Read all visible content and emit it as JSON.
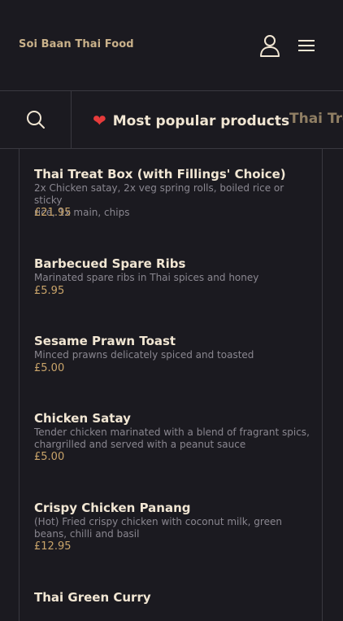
{
  "header": {
    "brand": "Soi Baan Thai Food",
    "user_icon": "user-icon",
    "menu_icon": "menu-icon"
  },
  "tabs": {
    "search_icon": "search-icon",
    "items": [
      {
        "label": "Most popular products",
        "icon": "heart-icon",
        "active": true
      },
      {
        "label": "Thai Treat",
        "active": false
      }
    ]
  },
  "products": [
    {
      "title": "Thai Treat Box (with Fillings' Choice)",
      "desc_lines": [
        "2x Chicken satay, 2x veg spring rolls, boiled rice or sticky",
        "rice, 1x main, chips"
      ],
      "price": "£21.95"
    },
    {
      "title": "Barbecued Spare Ribs",
      "desc_lines": [
        "Marinated spare ribs in Thai spices and honey"
      ],
      "price": "£5.95"
    },
    {
      "title": "Sesame Prawn Toast",
      "desc_lines": [
        "Minced prawns delicately spiced and toasted"
      ],
      "price": "£5.00"
    },
    {
      "title": "Chicken Satay",
      "desc_lines": [
        "Tender chicken marinated with a blend of fragrant spics,",
        "chargrilled and served with a peanut sauce"
      ],
      "price": "£5.00"
    },
    {
      "title": "Crispy Chicken Panang",
      "desc_lines": [
        "(Hot) Fried crispy chicken with coconut milk, green",
        "beans, chilli and basil"
      ],
      "price": "£12.95"
    },
    {
      "title": "Thai Green Curry",
      "desc_lines": [],
      "price": ""
    }
  ],
  "colors": {
    "background": "#1b1a20",
    "title": "#f1e6d3",
    "brand": "#c9b18a",
    "price": "#c9a46a",
    "divider": "#3a3940",
    "heart": "#e63b3b"
  }
}
